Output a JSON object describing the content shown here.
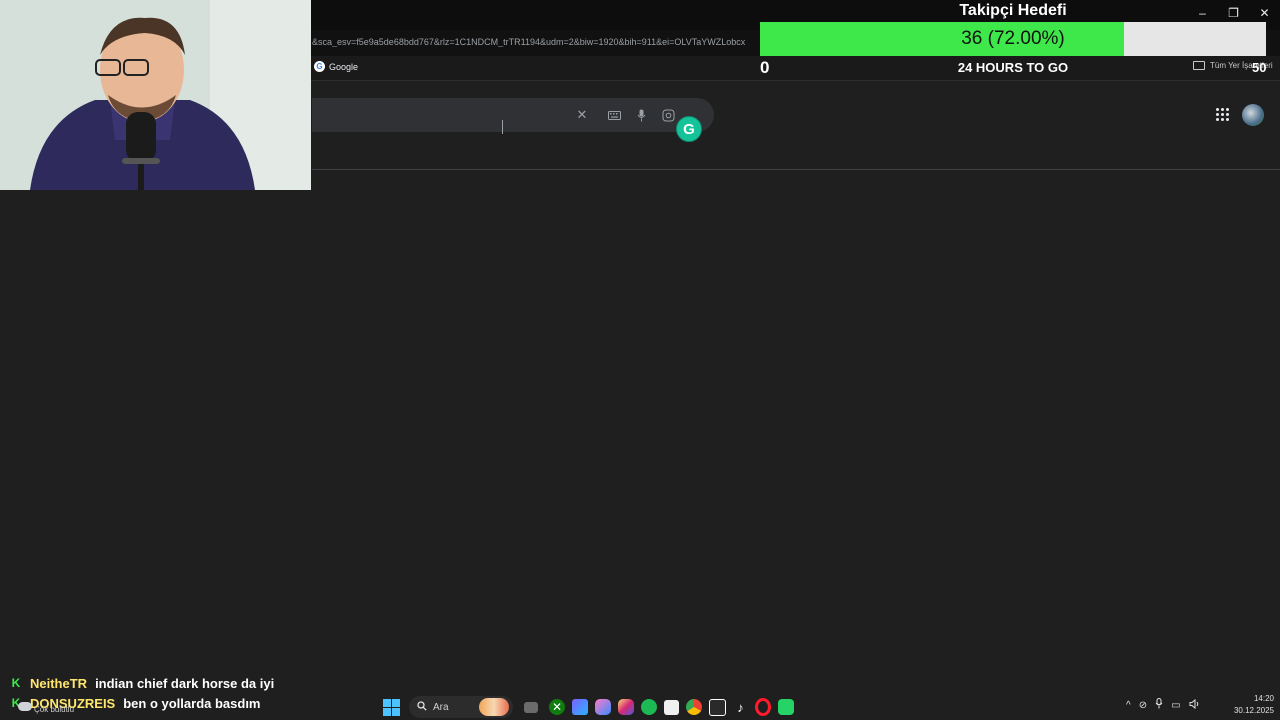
{
  "browser": {
    "url": "&sca_esv=f5e9a5de68bdd767&rlz=1C1NDCM_trTR1194&udm=2&biw=1920&bih=911&ei=OLVTaYWZLobcx",
    "window_controls": [
      "–",
      "❐",
      "✕"
    ],
    "bookmarks": [
      {
        "label": "Google",
        "icon": "google-icon"
      }
    ],
    "all_bookmarks_label": "Tüm Yer İşaretleri"
  },
  "google": {
    "search_value": "",
    "clear_icon": "✕",
    "keyboard_icon": "⌨",
    "mic_icon": "🎤",
    "lens_icon": "◎"
  },
  "grammarly": {
    "letter": "G"
  },
  "goal": {
    "title": "Takipçi Hedefi",
    "current_text": "36 (72.00%)",
    "progress": 0.72,
    "min": "0",
    "max": "50",
    "time_left": "24 HOURS TO GO",
    "fill_color": "#3ee84a",
    "track_color": "#e6e6e6"
  },
  "chat": [
    {
      "badge": "K",
      "user": "NeitheTR",
      "message": "indian chief dark horse da iyi"
    },
    {
      "badge": "K",
      "user": "DONSUZREIS",
      "message": "ben o yollarda basdım"
    }
  ],
  "taskbar": {
    "weather_label": "Çok bulutlu",
    "search_label": "Ara",
    "apps": [
      "start-icon",
      "search",
      "bing-icon",
      "file-explorer-icon",
      "xbox-icon",
      "m365-icon",
      "copilot-icon",
      "instagram-icon",
      "spotify-icon",
      "store-icon",
      "chrome-icon",
      "capcut-icon",
      "tiktok-icon",
      "opera-icon",
      "whatsapp-icon"
    ],
    "tray": [
      "^",
      "⊘",
      "🎤",
      "▭",
      "🔊"
    ],
    "time": "14:20",
    "date": "30.12.2025"
  }
}
